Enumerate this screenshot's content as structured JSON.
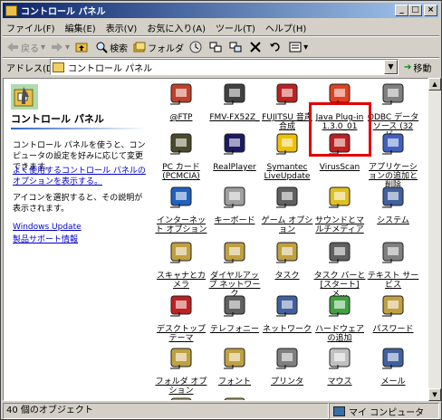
{
  "window": {
    "title": "コントロール パネル",
    "minimize": "_",
    "maximize": "□",
    "close": "×"
  },
  "menu": [
    "ファイル(F)",
    "編集(E)",
    "表示(V)",
    "お気に入り(A)",
    "ツール(T)",
    "ヘルプ(H)"
  ],
  "toolbar": {
    "back": "戻る",
    "forward": "",
    "search": "検索",
    "folders": "フォルダ"
  },
  "address": {
    "label": "アドレス(D)",
    "value": "コントロール パネル",
    "go": "移動"
  },
  "left": {
    "title": "コントロール パネル",
    "desc1": "コントロール パネルを使うと、コンピュータの設定を好みに応じて変更できます。",
    "link1": "よく使用するコントロール パネルのオプションを表示する。",
    "desc2": "アイコンを選択すると、その説明が表示されます。",
    "link2": "Windows Update",
    "link3": "製品サポート情報"
  },
  "icons": [
    {
      "label": "@FTP",
      "icon": "ftp-icon",
      "color": "#c0402a"
    },
    {
      "label": "FMV-FX52Z_",
      "icon": "tools-icon",
      "color": "#404040"
    },
    {
      "label": "FUJITSU 音声合成",
      "icon": "speech-icon",
      "color": "#c02020"
    },
    {
      "label": "Java Plug-in 1.3.0_01",
      "icon": "java-icon",
      "color": "#e04020"
    },
    {
      "label": "ODBC データソース (32ビ...",
      "icon": "odbc-icon",
      "color": "#808080"
    },
    {
      "label": "PC カード (PCMCIA)",
      "icon": "pccard-icon",
      "color": "#4a4a2a"
    },
    {
      "label": "RealPlayer",
      "icon": "realplayer-icon",
      "color": "#1a1a60"
    },
    {
      "label": "Symantec LiveUpdate",
      "icon": "liveupdate-icon",
      "color": "#f0c000"
    },
    {
      "label": "VirusScan",
      "icon": "virusscan-icon",
      "color": "#c02020"
    },
    {
      "label": "アプリケーションの追加と削除",
      "icon": "addremove-icon",
      "color": "#4060c0"
    },
    {
      "label": "インターネット オプション",
      "icon": "internet-options-icon",
      "color": "#2060c0"
    },
    {
      "label": "キーボード",
      "icon": "keyboard-icon",
      "color": "#a0a0a0"
    },
    {
      "label": "ゲーム オプション",
      "icon": "joystick-icon",
      "color": "#606060"
    },
    {
      "label": "サウンドとマルチメディア",
      "icon": "speaker-icon",
      "color": "#e0c020"
    },
    {
      "label": "システム",
      "icon": "system-icon",
      "color": "#4060a0"
    },
    {
      "label": "スキャナとカメラ",
      "icon": "scanner-icon",
      "color": "#c0a040"
    },
    {
      "label": "ダイヤルアップ ネットワーク",
      "icon": "dialup-icon",
      "color": "#c0a040"
    },
    {
      "label": "タスク",
      "icon": "tasks-icon",
      "color": "#c0a040"
    },
    {
      "label": "タスク バーと [スタート] メ...",
      "icon": "taskbar-icon",
      "color": "#606060"
    },
    {
      "label": "テキスト サービス",
      "icon": "textservice-icon",
      "color": "#808080"
    },
    {
      "label": "デスクトップ テーマ",
      "icon": "desktop-theme-icon",
      "color": "#c02020"
    },
    {
      "label": "テレフォニー",
      "icon": "telephony-icon",
      "color": "#606060"
    },
    {
      "label": "ネットワーク",
      "icon": "network-icon",
      "color": "#4060a0"
    },
    {
      "label": "ハードウェアの追加",
      "icon": "hardware-icon",
      "color": "#40a040"
    },
    {
      "label": "パスワード",
      "icon": "password-icon",
      "color": "#c0a040"
    },
    {
      "label": "フォルダ オプション",
      "icon": "folder-options-icon",
      "color": "#c0a040"
    },
    {
      "label": "フォント",
      "icon": "fonts-icon",
      "color": "#c0a040"
    },
    {
      "label": "プリンタ",
      "icon": "printer-icon",
      "color": "#808080"
    },
    {
      "label": "マウス",
      "icon": "mouse-icon",
      "color": "#c0c0c0"
    },
    {
      "label": "メール",
      "icon": "mail-icon",
      "color": "#4060a0"
    },
    {
      "label": "",
      "icon": "partial-icon",
      "color": "#c0a040"
    },
    {
      "label": "",
      "icon": "partial-icon",
      "color": "#c0a040"
    }
  ],
  "status": {
    "count": "40 個のオブジェクト",
    "zone": "マイ コンピュータ"
  }
}
